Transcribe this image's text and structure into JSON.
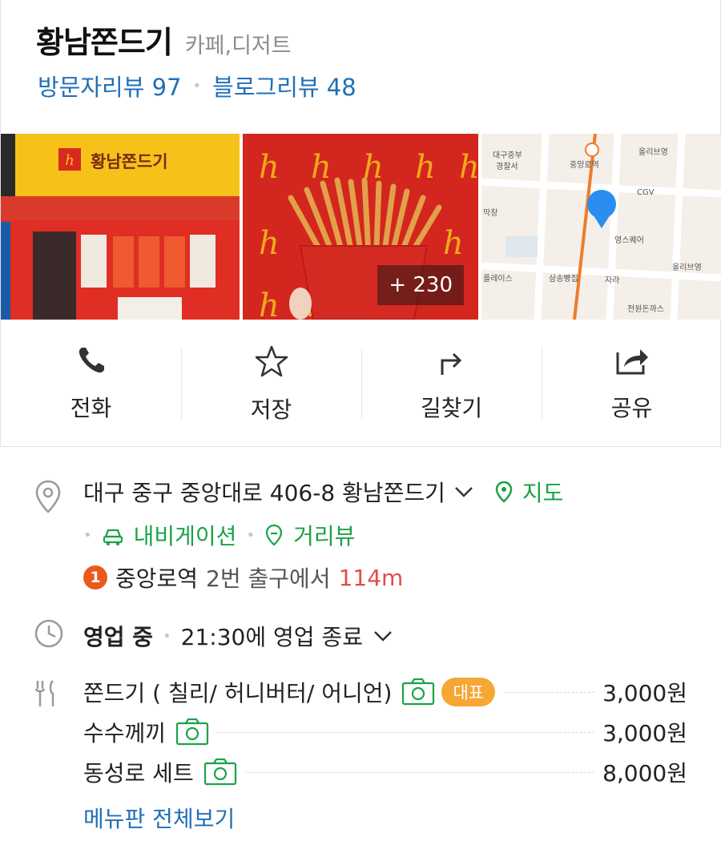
{
  "place": {
    "name": "황남쫀드기",
    "category": "카페,디저트",
    "visitor_reviews": "방문자리뷰 97",
    "blog_reviews": "블로그리뷰 48"
  },
  "photos": {
    "more_count": "+ 230",
    "storefront_sign": "황남쫀드기",
    "map_labels": [
      "대구중부",
      "경찰서",
      "중앙로역",
      "올리브영",
      "CGV",
      "영스퀘어",
      "삼송빵집",
      "자라",
      "올리브영",
      "전원돈까스",
      "플레이스",
      "막창"
    ]
  },
  "actions": [
    {
      "label": "전화",
      "icon": "phone-icon"
    },
    {
      "label": "저장",
      "icon": "star-icon"
    },
    {
      "label": "길찾기",
      "icon": "directions-icon"
    },
    {
      "label": "공유",
      "icon": "share-icon"
    }
  ],
  "info": {
    "address": "대구 중구 중앙대로 406-8 황남쫀드기",
    "map_link": "지도",
    "navigation_link": "내비게이션",
    "street_view_link": "거리뷰",
    "station_number": "1",
    "station_name": "중앙로역",
    "station_exit": "2번 출구에서",
    "station_distance": "114m",
    "hours_status": "영업 중",
    "hours_detail": "21:30에 영업 종료"
  },
  "menu": {
    "items": [
      {
        "name": "쫀드기 ( 칠리/ 허니버터/ 어니언)",
        "price": "3,000원",
        "badge": "대표"
      },
      {
        "name": "수수께끼",
        "price": "3,000원"
      },
      {
        "name": "동성로 세트",
        "price": "8,000원"
      }
    ],
    "view_all": "메뉴판 전체보기"
  },
  "colors": {
    "link_blue": "#1f6fb7",
    "green": "#1aa347",
    "distance_red": "#e34b4b",
    "badge_orange": "#f6a633",
    "station_badge": "#e85a1b"
  }
}
